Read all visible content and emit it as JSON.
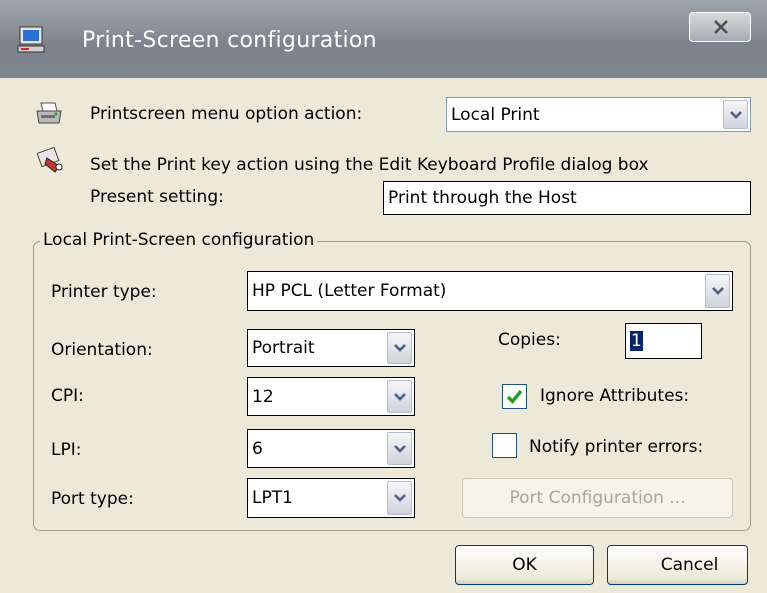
{
  "window": {
    "title": "Print-Screen configuration",
    "close_label": "X"
  },
  "printscreen_action": {
    "label": "Printscreen menu option action:",
    "value": "Local Print"
  },
  "print_key": {
    "info": "Set the Print key action using the Edit Keyboard Profile dialog box",
    "present_label": "Present setting:",
    "present_value": "Print through the Host"
  },
  "group": {
    "title": "Local Print-Screen configuration",
    "printer_type": {
      "label": "Printer type:",
      "value": "HP PCL (Letter Format)"
    },
    "orientation": {
      "label": "Orientation:",
      "value": "Portrait"
    },
    "cpi": {
      "label": "CPI:",
      "value": "12"
    },
    "lpi": {
      "label": "LPI:",
      "value": "6"
    },
    "port_type": {
      "label": "Port type:",
      "value": "LPT1"
    },
    "copies": {
      "label": "Copies:",
      "value": "1"
    },
    "ignore_attributes": {
      "label": "Ignore Attributes:",
      "checked": true
    },
    "notify_errors": {
      "label": "Notify printer errors:",
      "checked": false
    },
    "port_config_label": "Port Configuration ..."
  },
  "buttons": {
    "ok": "OK",
    "cancel": "Cancel"
  },
  "colors": {
    "checkmark": "#21a121",
    "title_bar": "#858c95"
  }
}
